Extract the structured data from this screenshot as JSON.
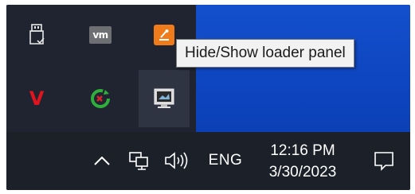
{
  "tooltip": {
    "text": "Hide/Show loader panel"
  },
  "tray": {
    "icons": [
      {
        "name": "usb-drive-icon"
      },
      {
        "name": "vmware-icon",
        "text": "vm"
      },
      {
        "name": "loader-app-icon"
      },
      {
        "name": "antivirus-v-icon",
        "text": "V"
      },
      {
        "name": "sync-refresh-icon"
      },
      {
        "name": "loader-panel-icon"
      }
    ]
  },
  "taskbar": {
    "language": "ENG",
    "time": "12:16 PM",
    "date": "3/30/2023"
  },
  "colors": {
    "desktop": "#0e45c0",
    "tray_bg": "#1f2430",
    "taskbar_bg": "#1c2029",
    "tooltip_bg": "#f2f2f2"
  }
}
